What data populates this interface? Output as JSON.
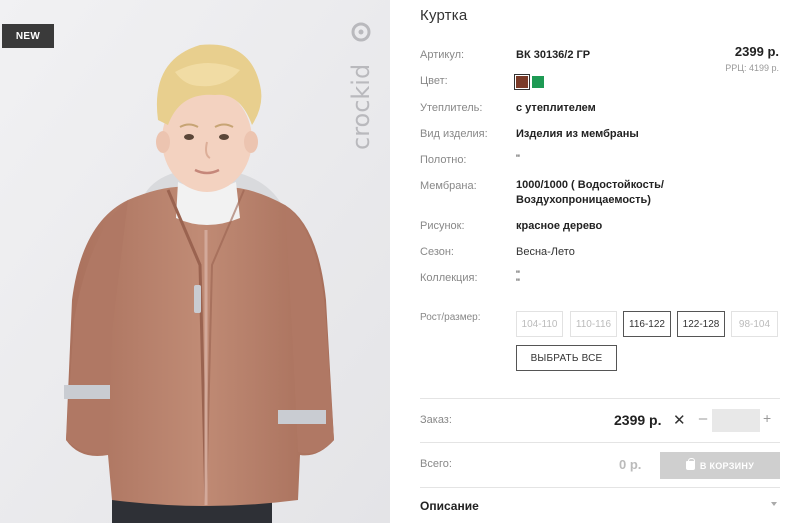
{
  "image": {
    "badge": "NEW",
    "brand": "crockid"
  },
  "product": {
    "title": "Куртка",
    "price": "2399 р.",
    "rrp": "РРЦ: 4199 р.",
    "attributes": [
      {
        "label": "Артикул:",
        "value": "ВК 30136/2 ГР"
      },
      {
        "label": "Цвет:",
        "value": ""
      },
      {
        "label": "Утеплитель:",
        "value": "с утеплителем"
      },
      {
        "label": "Вид изделия:",
        "value": "Изделия из мембраны"
      },
      {
        "label": "Полотно:",
        "value": "\""
      },
      {
        "label": "Мембрана:",
        "value": "1000/1000 ( Водостойкость/",
        "value2": "Воздухопроницаемость)"
      },
      {
        "label": "Рисунок:",
        "value": "красное дерево"
      },
      {
        "label": "Сезон:",
        "value": "Весна-Лето"
      },
      {
        "label": "Коллекция:",
        "value": "\"",
        "value2": "\""
      }
    ],
    "colors": [
      "#7a3a28",
      "#1e9a54"
    ],
    "size_label": "Рост/размер:",
    "sizes": [
      {
        "label": "104-110",
        "available": false
      },
      {
        "label": "110-116",
        "available": false
      },
      {
        "label": "116-122",
        "available": true
      },
      {
        "label": "122-128",
        "available": true
      },
      {
        "label": "98-104",
        "available": false
      }
    ],
    "select_all": "ВЫБРАТЬ ВСЕ"
  },
  "order": {
    "label": "Заказ:",
    "price": "2399 р.",
    "times": "✕",
    "minus": "–",
    "plus": "+",
    "quantity": ""
  },
  "total": {
    "label": "Всего:",
    "value": "0 р.",
    "cart_button": "В КОРЗИНУ"
  },
  "description": {
    "label": "Описание"
  }
}
